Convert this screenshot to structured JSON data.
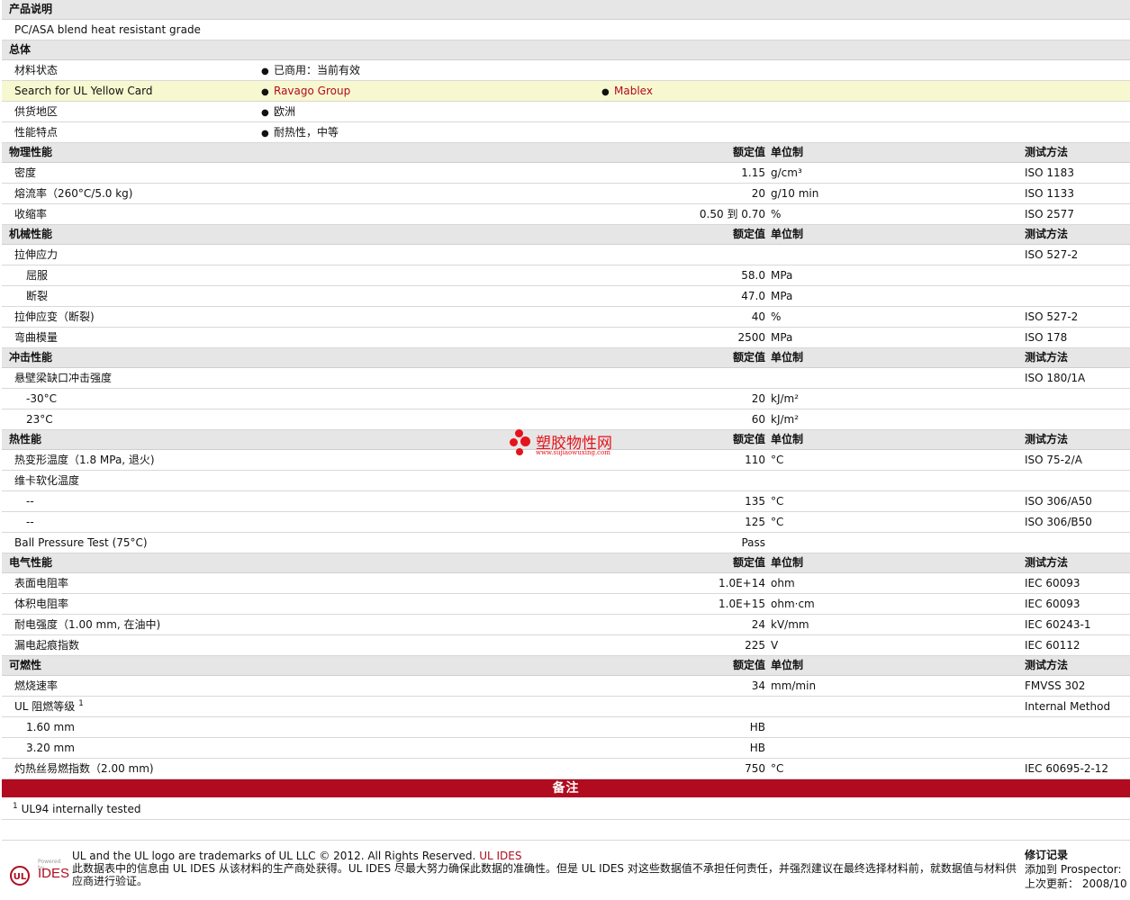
{
  "doc": {
    "product_desc_title": "产品说明",
    "product_desc": "PC/ASA blend heat resistant grade",
    "general_title": "总体",
    "general_rows": [
      {
        "label": "材料状态",
        "items": [
          "已商用：当前有效"
        ],
        "highlight": false
      },
      {
        "label": "Search for UL Yellow Card",
        "items": [
          "Ravago Group",
          "Mablex"
        ],
        "highlight": true,
        "links": true
      },
      {
        "label": "供货地区",
        "items": [
          "欧洲"
        ],
        "highlight": false
      },
      {
        "label": "性能特点",
        "items": [
          "耐热性，中等"
        ],
        "highlight": false
      }
    ],
    "col_value": "额定值",
    "col_unit": "单位制",
    "col_method": "测试方法"
  },
  "sections": [
    {
      "title": "物理性能",
      "rows": [
        {
          "label": "密度",
          "value": "1.15",
          "unit": "g/cm³",
          "method": "ISO 1183"
        },
        {
          "label": "熔流率（260°C/5.0 kg)",
          "value": "20",
          "unit": "g/10 min",
          "method": "ISO 1133"
        },
        {
          "label": "收缩率",
          "value": "0.50 到  0.70",
          "unit": "%",
          "method": "ISO 2577"
        }
      ]
    },
    {
      "title": "机械性能",
      "rows": [
        {
          "label": "拉伸应力",
          "value": "",
          "unit": "",
          "method": "ISO 527-2"
        },
        {
          "label": "屈服",
          "value": "58.0",
          "unit": "MPa",
          "method": "",
          "sub": true
        },
        {
          "label": "断裂",
          "value": "47.0",
          "unit": "MPa",
          "method": "",
          "sub": true
        },
        {
          "label": "拉伸应变（断裂)",
          "value": "40",
          "unit": "%",
          "method": "ISO 527-2"
        },
        {
          "label": "弯曲模量",
          "value": "2500",
          "unit": "MPa",
          "method": "ISO 178"
        }
      ]
    },
    {
      "title": "冲击性能",
      "rows": [
        {
          "label": "悬壁梁缺口冲击强度",
          "value": "",
          "unit": "",
          "method": "ISO 180/1A"
        },
        {
          "label": "-30°C",
          "value": "20",
          "unit": "kJ/m²",
          "method": "",
          "sub": true
        },
        {
          "label": "23°C",
          "value": "60",
          "unit": "kJ/m²",
          "method": "",
          "sub": true
        }
      ]
    },
    {
      "title": "热性能",
      "rows": [
        {
          "label": "热变形温度（1.8 MPa, 退火)",
          "value": "110",
          "unit": "°C",
          "method": "ISO 75-2/A"
        },
        {
          "label": "维卡软化温度",
          "value": "",
          "unit": "",
          "method": ""
        },
        {
          "label": "--",
          "value": "135",
          "unit": "°C",
          "method": "ISO 306/A50",
          "sub": true
        },
        {
          "label": "--",
          "value": "125",
          "unit": "°C",
          "method": "ISO 306/B50",
          "sub": true
        },
        {
          "label": "Ball Pressure Test (75°C)",
          "value": "Pass",
          "unit": "",
          "method": ""
        }
      ]
    },
    {
      "title": "电气性能",
      "rows": [
        {
          "label": "表面电阻率",
          "value": "1.0E+14",
          "unit": "ohm",
          "method": "IEC 60093"
        },
        {
          "label": "体积电阻率",
          "value": "1.0E+15",
          "unit": "ohm·cm",
          "method": "IEC 60093"
        },
        {
          "label": "耐电强度（1.00 mm, 在油中)",
          "value": "24",
          "unit": "kV/mm",
          "method": "IEC 60243-1"
        },
        {
          "label": "漏电起痕指数",
          "value": "225",
          "unit": "V",
          "method": "IEC 60112"
        }
      ]
    },
    {
      "title": "可燃性",
      "rows": [
        {
          "label": "燃烧速率",
          "value": "34",
          "unit": "mm/min",
          "method": "FMVSS 302"
        },
        {
          "label": "UL 阻燃等级",
          "sup": "1",
          "value": "",
          "unit": "",
          "method": "Internal Method"
        },
        {
          "label": "1.60 mm",
          "value": "HB",
          "unit": "",
          "method": "",
          "sub": true
        },
        {
          "label": "3.20 mm",
          "value": "HB",
          "unit": "",
          "method": "",
          "sub": true
        },
        {
          "label": "灼热丝易燃指数（2.00 mm)",
          "value": "750",
          "unit": "°C",
          "method": "IEC 60695-2-12"
        }
      ]
    }
  ],
  "notes": {
    "title": "备注",
    "footnote_num": "1",
    "footnote_text": "UL94 internally tested"
  },
  "footer": {
    "powered": "Powered by",
    "logo_ul": "UL",
    "logo_ides": "IDES",
    "line1": "UL and the UL logo are trademarks of UL LLC © 2012. All Rights Reserved.",
    "line1_link": "UL IDES",
    "line2": "此数据表中的信息由  UL IDES 从该材料的生产商处获得。UL IDES 尽最大努力确保此数据的准确性。但是  UL IDES 对这些数据值不承担任何责任，并强烈建议在最终选择材料前，就数据值与材料供应商进行验证。",
    "rev_title": "修订记录",
    "rev_added": "添加到   Prospector:",
    "rev_updated": "上次更新：   2008/10"
  },
  "watermark": {
    "name": "塑胶物性网",
    "url": "www.sujiaowuxing.com"
  }
}
